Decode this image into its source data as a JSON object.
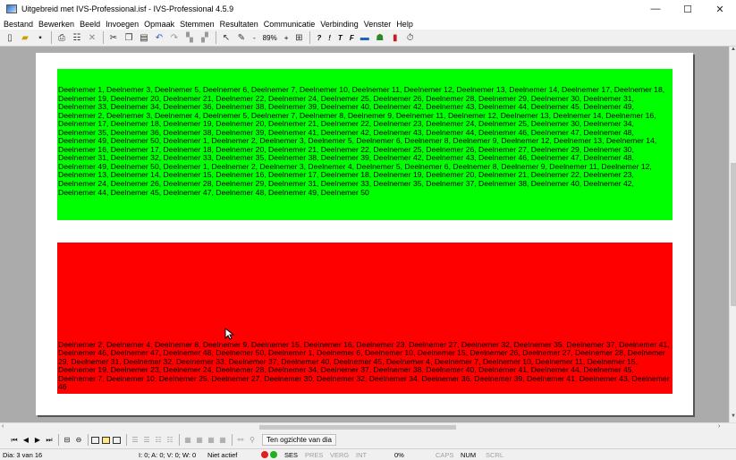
{
  "window": {
    "title": "Uitgebreid met IVS-Professional.isf - IVS-Professional 4.5.9",
    "minimize": "—",
    "maximize": "☐",
    "close": "✕"
  },
  "menu": {
    "items": [
      "Bestand",
      "Bewerken",
      "Beeld",
      "Invoegen",
      "Opmaak",
      "Stemmen",
      "Resultaten",
      "Communicatie",
      "Verbinding",
      "Venster",
      "Help"
    ]
  },
  "toolbar": {
    "zoom_minus": "-",
    "zoom_value": "89%",
    "zoom_plus": "+",
    "question_label": "?",
    "exclaim_label": "!",
    "t_label": "T",
    "f_label": "F"
  },
  "slide": {
    "green_text": "Deelnemer 1, Deelnemer 3, Deelnemer 5, Deelnemer 6, Deelnemer 7, Deelnemer 10, Deelnemer 11, Deelnemer 12, Deelnemer 13, Deelnemer 14, Deelnemer 17, Deelnemer 18, Deelnemer 19, Deelnemer 20, Deelnemer 21, Deelnemer 22, Deelnemer 24, Deelnemer 25, Deelnemer 26, Deelnemer 28, Deelnemer 29, Deelnemer 30, Deelnemer 31, Deelnemer 33, Deelnemer 34, Deelnemer 36, Deelnemer 38, Deelnemer 39, Deelnemer 40, Deelnemer 42, Deelnemer 43, Deelnemer 44, Deelnemer 45, Deelnemer 49, Deelnemer 2, Deelnemer 3, Deelnemer 4, Deelnemer 5, Deelnemer 7, Deelnemer 8, Deelnemer 9, Deelnemer 11, Deelnemer 12, Deelnemer 13, Deelnemer 14, Deelnemer 16, Deelnemer 17, Deelnemer 18, Deelnemer 19, Deelnemer 20, Deelnemer 21, Deelnemer 22, Deelnemer 23, Deelnemer 24, Deelnemer 25, Deelnemer 30, Deelnemer 34, Deelnemer 35, Deelnemer 36, Deelnemer 38, Deelnemer 39, Deelnemer 41, Deelnemer 42, Deelnemer 43, Deelnemer 44, Deelnemer 46, Deelnemer 47, Deelnemer 48, Deelnemer 49, Deelnemer 50, Deelnemer 1, Deelnemer 2, Deelnemer 3, Deelnemer 5, Deelnemer 6, Deelnemer 8, Deelnemer 9, Deelnemer 12, Deelnemer 13, Deelnemer 14, Deelnemer 16, Deelnemer 17, Deelnemer 18, Deelnemer 20, Deelnemer 21, Deelnemer 22, Deelnemer 25, Deelnemer 26, Deelnemer 27, Deelnemer 29, Deelnemer 30, Deelnemer 31, Deelnemer 32, Deelnemer 33, Deelnemer 35, Deelnemer 38, Deelnemer 39, Deelnemer 42, Deelnemer 43, Deelnemer 46, Deelnemer 47, Deelnemer 48, Deelnemer 49, Deelnemer 50, Deelnemer 1, Deelnemer 2, Deelnemer 3, Deelnemer 4, Deelnemer 5, Deelnemer 6, Deelnemer 8, Deelnemer 9, Deelnemer 11, Deelnemer 12, Deelnemer 13, Deelnemer 14, Deelnemer 15, Deelnemer 16, Deelnemer 17, Deelnemer 18, Deelnemer 19, Deelnemer 20, Deelnemer 21, Deelnemer 22, Deelnemer 23, Deelnemer 24, Deelnemer 26, Deelnemer 28, Deelnemer 29, Deelnemer 31, Deelnemer 33, Deelnemer 35, Deelnemer 37, Deelnemer 38, Deelnemer 40, Deelnemer 42, Deelnemer 44, Deelnemer 45, Deelnemer 47, Deelnemer 48, Deelnemer 49, Deelnemer 50",
    "red_text": "Deelnemer 2, Deelnemer 4, Deelnemer 8, Deelnemer 9, Deelnemer 15, Deelnemer 16, Deelnemer 23, Deelnemer 27, Deelnemer 32, Deelnemer 35, Deelnemer 37, Deelnemer 41, Deelnemer 46, Deelnemer 47, Deelnemer 48, Deelnemer 50, Deelnemer 1, Deelnemer 6, Deelnemer 10, Deelnemer 15, Deelnemer 26, Deelnemer 27, Deelnemer 28, Deelnemer 29, Deelnemer 31, Deelnemer 32, Deelnemer 33, Deelnemer 37, Deelnemer 40, Deelnemer 45, Deelnemer 4, Deelnemer 7, Deelnemer 10, Deelnemer 11, Deelnemer 15, Deelnemer 19, Deelnemer 23, Deelnemer 24, Deelnemer 28, Deelnemer 34, Deelnemer 37, Deelnemer 38, Deelnemer 40, Deelnemer 41, Deelnemer 44, Deelnemer 45, Deelnemer 7, Deelnemer 10, Deelnemer 25, Deelnemer 27, Deelnemer 30, Deelnemer 32, Deelnemer 34, Deelnemer 36, Deelnemer 39, Deelnemer 41, Deelnemer 43, Deelnemer 46",
    "green_color": "#00ff00",
    "red_color": "#ff0000"
  },
  "navigation": {
    "overview_button": "Ten ogzichte van dia"
  },
  "status": {
    "slide": "Dia: 3 van 16",
    "counts": "I: 0;  A: 0;  V: 0;  W: 0",
    "state": "Niet actief",
    "ses": "SES",
    "pres": "PRES",
    "verg": "VERG",
    "int": "INT",
    "percent": "0%",
    "caps": "CAPS",
    "num": "NUM",
    "scrl": "SCRL"
  }
}
